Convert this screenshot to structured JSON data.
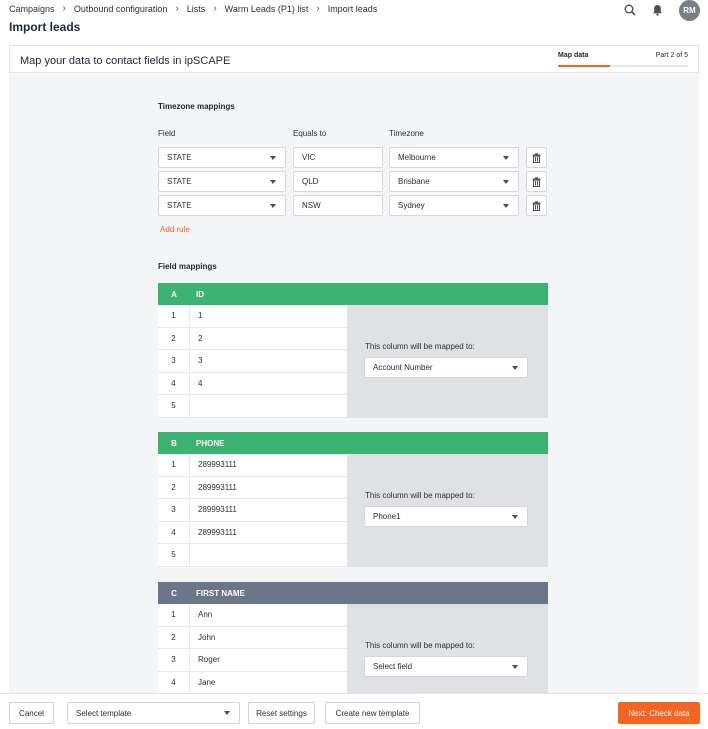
{
  "breadcrumb": [
    "Campaigns",
    "Outbound configuration",
    "Lists",
    "Warm Leads (P1) list",
    "Import leads"
  ],
  "page_title": "Import leads",
  "user_initials": "RM",
  "card": {
    "title": "Map your data to contact fields in ipSCAPE",
    "step_label": "Map data",
    "step_progress": "Part 2 of 5",
    "step_fraction": 0.4
  },
  "timezone": {
    "section_title": "Timezone mappings",
    "col_field": "Field",
    "col_equals": "Equals to",
    "col_timezone": "Timezone",
    "rules": [
      {
        "field": "STATE",
        "equals": "VIC",
        "timezone": "Melbourne"
      },
      {
        "field": "STATE",
        "equals": "QLD",
        "timezone": "Brisbane"
      },
      {
        "field": "STATE",
        "equals": "NSW",
        "timezone": "Sydney"
      }
    ],
    "add_rule": "Add rule"
  },
  "field_mappings": {
    "section_title": "Field mappings",
    "hint": "This column will be mapped to:",
    "columns": [
      {
        "letter": "A",
        "name": "ID",
        "color": "#3cb371",
        "rows": [
          "1",
          "2",
          "3",
          "4",
          ""
        ],
        "mapped_to": "Account Number"
      },
      {
        "letter": "B",
        "name": "PHONE",
        "color": "#3cb371",
        "rows": [
          "289993111",
          "289993111",
          "289993111",
          "289993111",
          ""
        ],
        "mapped_to": "Phone1"
      },
      {
        "letter": "C",
        "name": "FIRST NAME",
        "color": "#6b7689",
        "rows": [
          "Ann",
          "John",
          "Roger",
          "Jane"
        ],
        "mapped_to": "Select field"
      }
    ]
  },
  "footer": {
    "cancel": "Cancel",
    "template_placeholder": "Select template",
    "reset": "Reset settings",
    "create_template": "Create new template",
    "next": "Next: Check data"
  },
  "colors": {
    "accent": "#f26522",
    "mapped_header": "#3cb371",
    "unmapped_header": "#6b7689"
  }
}
